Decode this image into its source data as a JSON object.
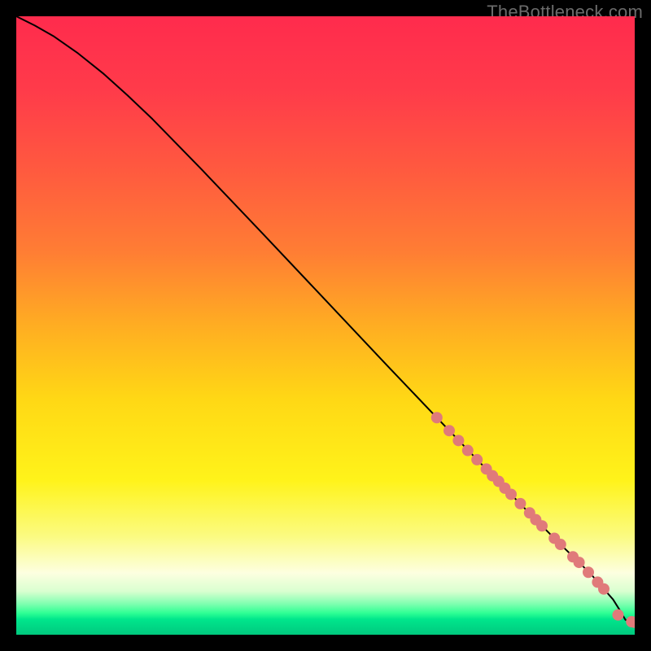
{
  "watermark": "TheBottleneck.com",
  "chart_data": {
    "type": "line",
    "title": "",
    "xlabel": "",
    "ylabel": "",
    "xlim": [
      0,
      100
    ],
    "ylim": [
      0,
      100
    ],
    "grid": false,
    "legend": false,
    "background_gradient_stops": [
      {
        "offset": 0.0,
        "color": "#ff2b4d"
      },
      {
        "offset": 0.12,
        "color": "#ff3b4a"
      },
      {
        "offset": 0.25,
        "color": "#ff5a3f"
      },
      {
        "offset": 0.38,
        "color": "#ff7d34"
      },
      {
        "offset": 0.5,
        "color": "#ffad22"
      },
      {
        "offset": 0.62,
        "color": "#ffd815"
      },
      {
        "offset": 0.75,
        "color": "#fff31a"
      },
      {
        "offset": 0.84,
        "color": "#fbfb80"
      },
      {
        "offset": 0.9,
        "color": "#fdffe0"
      },
      {
        "offset": 0.93,
        "color": "#d9ffd0"
      },
      {
        "offset": 0.95,
        "color": "#7fffb0"
      },
      {
        "offset": 0.965,
        "color": "#2fff94"
      },
      {
        "offset": 0.975,
        "color": "#00e68c"
      },
      {
        "offset": 1.0,
        "color": "#00c97e"
      }
    ],
    "series": [
      {
        "name": "curve",
        "color": "#000000",
        "stroke_width": 2,
        "x": [
          0,
          3,
          6,
          10,
          14,
          18,
          22,
          30,
          40,
          50,
          60,
          68,
          75,
          80,
          84,
          88,
          91,
          93,
          95,
          96.5,
          97.5,
          98.5,
          100
        ],
        "y": [
          100,
          98.5,
          96.8,
          94,
          90.8,
          87.2,
          83.4,
          75.2,
          64.7,
          54.1,
          43.5,
          35.1,
          27.8,
          22.7,
          18.6,
          14.6,
          11.7,
          9.7,
          7.4,
          5.7,
          4.1,
          2.4,
          2.0
        ]
      }
    ],
    "scatter": {
      "name": "points",
      "color": "#e07a7a",
      "radius": 7,
      "x": [
        68,
        70,
        71.5,
        73,
        74.5,
        76,
        77,
        78,
        79,
        80,
        81.5,
        83,
        84,
        85,
        87,
        88,
        90,
        91,
        92.5,
        94,
        95,
        97.3,
        99.5,
        100
      ],
      "y": [
        35.1,
        33.0,
        31.4,
        29.8,
        28.3,
        26.8,
        25.7,
        24.8,
        23.7,
        22.7,
        21.2,
        19.7,
        18.6,
        17.6,
        15.6,
        14.6,
        12.6,
        11.7,
        10.1,
        8.5,
        7.4,
        3.2,
        2.1,
        2.0
      ]
    }
  }
}
